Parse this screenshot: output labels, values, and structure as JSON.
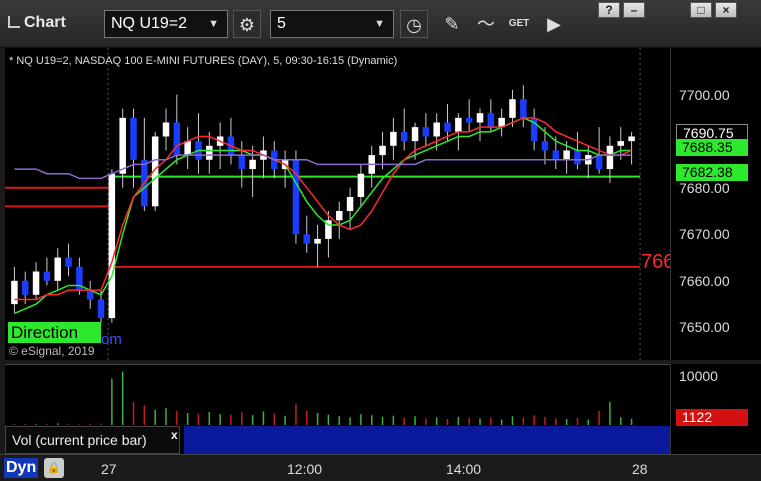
{
  "toolbar": {
    "title": "Chart",
    "symbol": "NQ U19=2",
    "interval": "5",
    "icons": [
      "settings-icon",
      "clock-icon",
      "pencil-icon",
      "study-icon",
      "get-icon",
      "play-icon"
    ],
    "win_buttons": [
      "?",
      "–",
      "□",
      "×"
    ]
  },
  "chart": {
    "description": "* NQ U19=2, NASDAQ 100 E-MINI FUTURES (DAY), 5, 09:30-16:15 (Dynamic)",
    "copyright": "© eSignal, 2019",
    "direction_label": "Direction",
    "direction_url_fragment": "om",
    "red_level_label": "766"
  },
  "price_axis": {
    "ticks": [
      "7700.00",
      "7690.00",
      "7680.00",
      "7670.00",
      "7660.00",
      "7650.00"
    ],
    "last_price": "7690.75",
    "ma_a": "7688.35",
    "ma_b": "7682.38"
  },
  "volume": {
    "study_label": "Vol (current price bar)",
    "close_symbol": "x",
    "axis_tick": "10000",
    "current": "1122"
  },
  "time_axis": {
    "mode": "Dyn",
    "labels": [
      "27",
      "12:00",
      "14:00",
      "28"
    ]
  },
  "colors": {
    "up": "#ffffff",
    "down": "#1a3cff",
    "ma_fast": "#2ee82e",
    "ma_slow": "#ff2a2a",
    "vwap": "#8d6ad0",
    "support": "#2ee82e",
    "resistance": "#d81818"
  },
  "chart_data": {
    "type": "candlestick",
    "title": "* NQ U19=2, NASDAQ 100 E-MINI FUTURES (DAY), 5, 09:30-16:15 (Dynamic)",
    "ylim": [
      7643,
      7710
    ],
    "series": [
      {
        "type": "candles",
        "ohlc": [
          [
            7655,
            7663,
            7653,
            7660
          ],
          [
            7660,
            7662,
            7655,
            7657
          ],
          [
            7657,
            7664,
            7656,
            7662
          ],
          [
            7662,
            7665,
            7659,
            7660
          ],
          [
            7660,
            7667,
            7658,
            7665
          ],
          [
            7665,
            7668,
            7661,
            7663
          ],
          [
            7663,
            7665,
            7657,
            7658
          ],
          [
            7658,
            7660,
            7654,
            7656
          ],
          [
            7656,
            7658,
            7651,
            7652
          ],
          [
            7652,
            7684,
            7651,
            7683
          ],
          [
            7683,
            7697,
            7680,
            7695
          ],
          [
            7695,
            7697,
            7680,
            7686
          ],
          [
            7686,
            7695,
            7675,
            7676
          ],
          [
            7676,
            7692,
            7675,
            7691
          ],
          [
            7691,
            7697,
            7688,
            7694
          ],
          [
            7694,
            7700,
            7685,
            7687
          ],
          [
            7687,
            7693,
            7684,
            7690
          ],
          [
            7690,
            7696,
            7683,
            7686
          ],
          [
            7686,
            7692,
            7683,
            7689
          ],
          [
            7689,
            7694,
            7684,
            7691
          ],
          [
            7691,
            7695,
            7685,
            7687
          ],
          [
            7687,
            7690,
            7680,
            7684
          ],
          [
            7684,
            7689,
            7678,
            7686
          ],
          [
            7686,
            7691,
            7682,
            7688
          ],
          [
            7688,
            7690,
            7682,
            7684
          ],
          [
            7684,
            7688,
            7680,
            7686
          ],
          [
            7686,
            7688,
            7668,
            7670
          ],
          [
            7670,
            7674,
            7666,
            7668
          ],
          [
            7668,
            7672,
            7663,
            7669
          ],
          [
            7669,
            7675,
            7665,
            7673
          ],
          [
            7673,
            7677,
            7669,
            7675
          ],
          [
            7675,
            7680,
            7671,
            7678
          ],
          [
            7678,
            7685,
            7676,
            7683
          ],
          [
            7683,
            7689,
            7680,
            7687
          ],
          [
            7687,
            7692,
            7684,
            7689
          ],
          [
            7689,
            7695,
            7686,
            7692
          ],
          [
            7692,
            7697,
            7688,
            7690
          ],
          [
            7690,
            7694,
            7686,
            7693
          ],
          [
            7693,
            7696,
            7689,
            7691
          ],
          [
            7691,
            7696,
            7688,
            7694
          ],
          [
            7694,
            7698,
            7690,
            7692
          ],
          [
            7692,
            7696,
            7688,
            7695
          ],
          [
            7695,
            7699,
            7692,
            7694
          ],
          [
            7694,
            7697,
            7690,
            7696
          ],
          [
            7696,
            7699,
            7692,
            7693
          ],
          [
            7693,
            7697,
            7691,
            7695
          ],
          [
            7695,
            7701,
            7693,
            7699
          ],
          [
            7699,
            7702,
            7693,
            7695
          ],
          [
            7695,
            7697,
            7688,
            7690
          ],
          [
            7690,
            7693,
            7685,
            7688
          ],
          [
            7688,
            7691,
            7684,
            7686
          ],
          [
            7686,
            7690,
            7683,
            7688
          ],
          [
            7688,
            7692,
            7684,
            7685
          ],
          [
            7685,
            7689,
            7682,
            7687
          ],
          [
            7687,
            7693,
            7683,
            7684
          ],
          [
            7684,
            7691,
            7681,
            7689
          ],
          [
            7689,
            7693,
            7686,
            7690
          ],
          [
            7690,
            7692,
            7685,
            7691
          ]
        ]
      },
      {
        "name": "",
        "type": "line",
        "color": "#2ee82e",
        "values": [
          7653,
          7654,
          7655,
          7657,
          7658,
          7659,
          7659,
          7658,
          7657,
          7661,
          7670,
          7678,
          7680,
          7682,
          7684,
          7686,
          7687,
          7688,
          7688,
          7688,
          7688,
          7688,
          7687,
          7687,
          7686,
          7685,
          7681,
          7677,
          7674,
          7672,
          7672,
          7673,
          7676,
          7679,
          7682,
          7684,
          7686,
          7687,
          7688,
          7689,
          7690,
          7691,
          7691,
          7692,
          7692,
          7693,
          7694,
          7695,
          7694,
          7692,
          7690,
          7689,
          7688,
          7688,
          7687,
          7687,
          7688,
          7688
        ]
      },
      {
        "name": "",
        "type": "line",
        "color": "#ff2a2a",
        "values": [
          7656,
          7656,
          7656,
          7657,
          7657,
          7658,
          7658,
          7658,
          7658,
          7664,
          7672,
          7678,
          7681,
          7684,
          7686,
          7689,
          7690,
          7691,
          7691,
          7690,
          7689,
          7688,
          7688,
          7687,
          7686,
          7685,
          7683,
          7680,
          7677,
          7674,
          7672,
          7671,
          7672,
          7675,
          7679,
          7683,
          7686,
          7688,
          7689,
          7690,
          7691,
          7692,
          7692,
          7693,
          7693,
          7693,
          7694,
          7695,
          7695,
          7694,
          7692,
          7691,
          7690,
          7689,
          7688,
          7687,
          7687,
          7688
        ]
      },
      {
        "name": "",
        "type": "line",
        "color": "#8d6ad0",
        "values": [
          7684,
          7684,
          7684,
          7683,
          7683,
          7683,
          7682,
          7682,
          7682,
          7683,
          7684,
          7685,
          7685,
          7686,
          7686,
          7687,
          7687,
          7687,
          7687,
          7687,
          7687,
          7687,
          7687,
          7687,
          7686,
          7686,
          7686,
          7686,
          7685,
          7685,
          7685,
          7685,
          7685,
          7685,
          7685,
          7685,
          7685,
          7685,
          7686,
          7686,
          7686,
          7686,
          7686,
          7686,
          7686,
          7686,
          7686,
          7686,
          7686,
          7686,
          7686,
          7686,
          7686,
          7686,
          7687,
          7687,
          7687,
          7687
        ]
      },
      {
        "name": "",
        "type": "hline",
        "color": "#2ee82e",
        "y": 7682.38,
        "x_from_frac": 0.16
      },
      {
        "name": "",
        "type": "hline",
        "color": "#d81818",
        "y": 7680,
        "x_from_frac": 0,
        "x_to_frac": 0.16
      },
      {
        "name": "",
        "type": "hline",
        "color": "#d81818",
        "y": 7676,
        "x_from_frac": 0,
        "x_to_frac": 0.16
      },
      {
        "name": "",
        "type": "hline",
        "color": "#d81818",
        "y": 7663,
        "x_from_frac": 0.16
      }
    ],
    "volume": [
      120,
      180,
      140,
      160,
      300,
      170,
      150,
      190,
      260,
      8500,
      9800,
      4200,
      3600,
      2800,
      3100,
      2600,
      2200,
      2100,
      2400,
      2000,
      1900,
      2300,
      1800,
      2500,
      2100,
      1700,
      3800,
      2600,
      2200,
      1900,
      1600,
      1400,
      2000,
      1800,
      1500,
      1700,
      1300,
      1600,
      1200,
      1400,
      1100,
      1500,
      1300,
      1200,
      1400,
      1000,
      1600,
      1300,
      1800,
      1500,
      1200,
      1100,
      1300,
      1000,
      2600,
      4200,
      1400,
      1122
    ],
    "volume_ylim": [
      0,
      11000
    ],
    "x_labels": [
      "27",
      "12:00",
      "14:00",
      "28"
    ]
  }
}
